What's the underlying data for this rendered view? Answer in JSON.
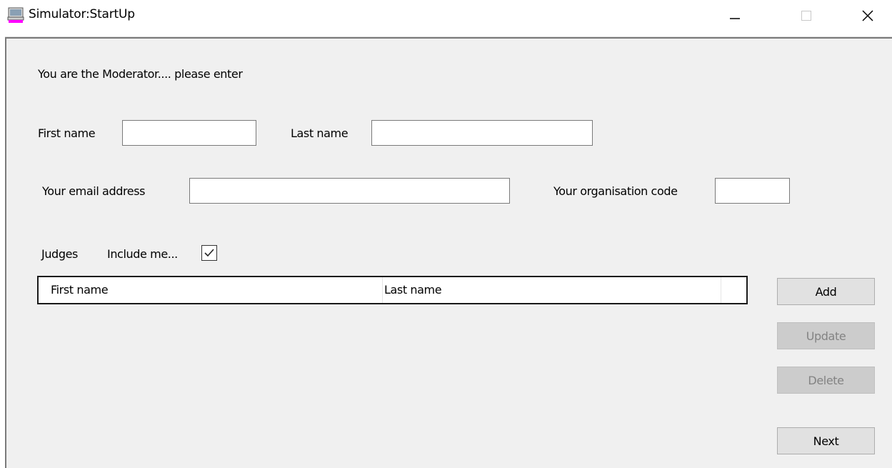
{
  "window": {
    "title": "Simulator:StartUp",
    "icon": "computer-icon"
  },
  "form": {
    "intro": "You are the Moderator.... please enter",
    "first_name_label": "First name",
    "first_name_value": "",
    "last_name_label": "Last name",
    "last_name_value": "",
    "email_label": "Your email address",
    "email_value": "",
    "org_code_label": "Your organisation code",
    "org_code_value": ""
  },
  "judges": {
    "label": "Judges",
    "include_me_label": "Include me...",
    "include_me_checked": true,
    "columns": [
      "First name",
      "Last name"
    ],
    "rows": []
  },
  "buttons": {
    "add": "Add",
    "update": "Update",
    "delete": "Delete",
    "next": "Next"
  },
  "colors": {
    "window_bg": "#f0f0f0",
    "disabled_button_bg": "#cccccc",
    "button_bg": "#e1e1e1"
  }
}
